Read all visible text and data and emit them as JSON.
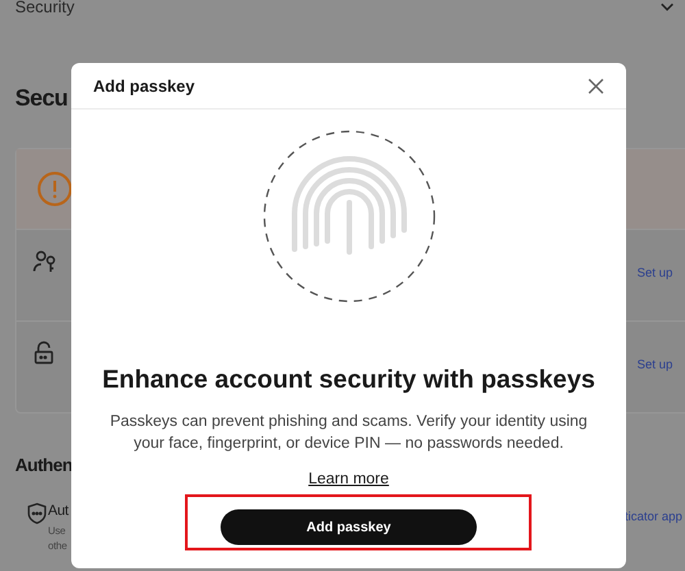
{
  "page": {
    "breadcrumb": "Security",
    "heading": "Secu",
    "rows": [
      {
        "kind": "person",
        "action": "Set up"
      },
      {
        "kind": "lock",
        "action": "Set up"
      }
    ],
    "section_heading": "Authen",
    "auth_row": {
      "title": "Aut",
      "lines": [
        "Use",
        "othe"
      ],
      "action": "ticator app"
    }
  },
  "dialog": {
    "title": "Add passkey",
    "heading": "Enhance account security with passkeys",
    "text": "Passkeys can prevent phishing and scams. Verify your identity using your face, fingerprint, or device PIN — no passwords needed.",
    "link": "Learn more",
    "button": "Add passkey",
    "button_highlighted": true
  }
}
